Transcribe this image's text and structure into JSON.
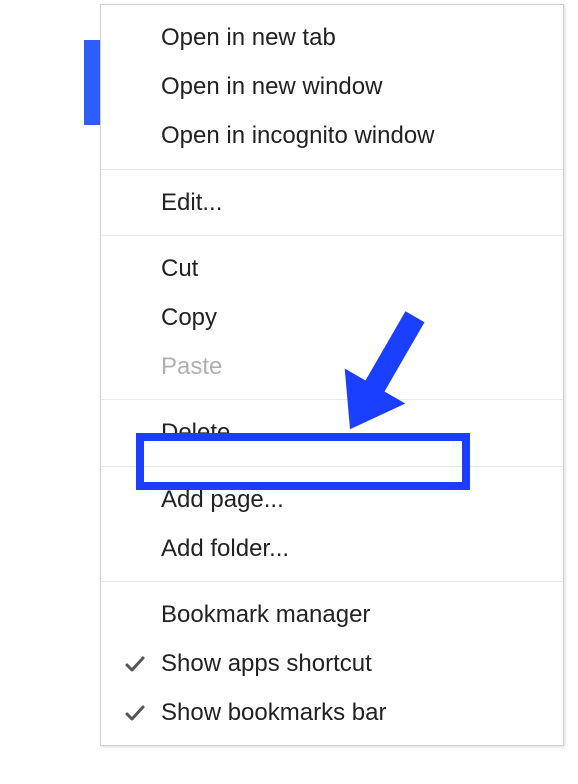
{
  "menu": {
    "group1": {
      "open_new_tab": "Open in new tab",
      "open_new_window": "Open in new window",
      "open_incognito": "Open in incognito window"
    },
    "group2": {
      "edit": "Edit..."
    },
    "group3": {
      "cut": "Cut",
      "copy": "Copy",
      "paste": "Paste"
    },
    "group4": {
      "delete": "Delete"
    },
    "group5": {
      "add_page": "Add page...",
      "add_folder": "Add folder..."
    },
    "group6": {
      "bookmark_manager": "Bookmark manager",
      "show_apps": "Show apps shortcut",
      "show_bookmarks": "Show bookmarks bar"
    }
  },
  "annotations": {
    "highlight_color": "#1a3fff",
    "arrow_color": "#1a3fff"
  }
}
